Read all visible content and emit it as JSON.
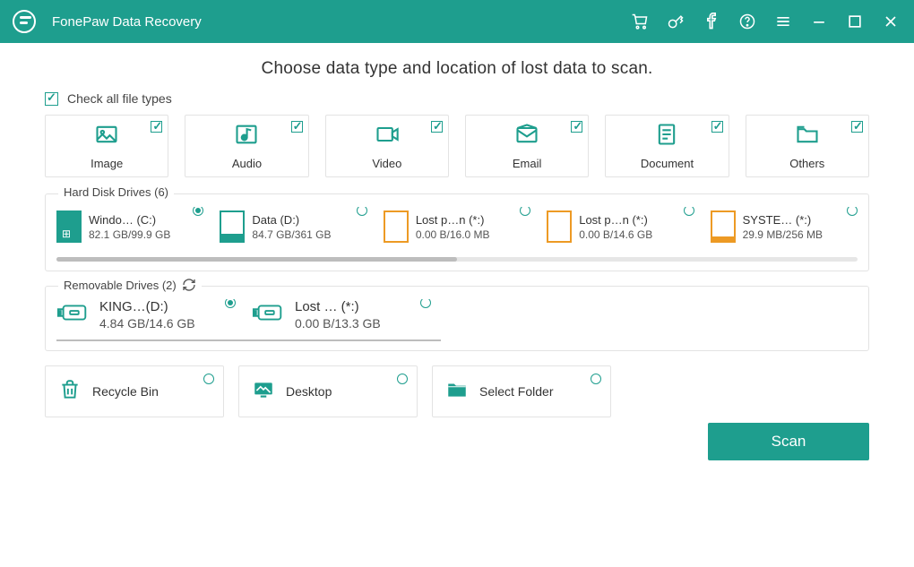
{
  "app_title": "FonePaw Data Recovery",
  "heading": "Choose data type and location of lost data to scan.",
  "check_all_label": "Check all file types",
  "types": [
    {
      "label": "Image"
    },
    {
      "label": "Audio"
    },
    {
      "label": "Video"
    },
    {
      "label": "Email"
    },
    {
      "label": "Document"
    },
    {
      "label": "Others"
    }
  ],
  "hdd_title": "Hard Disk Drives (6)",
  "hdd": [
    {
      "name": "Windo… (C:)",
      "size": "82.1 GB/99.9 GB",
      "selected": true,
      "style": "full-teal",
      "win": true
    },
    {
      "name": "Data (D:)",
      "size": "84.7 GB/361 GB",
      "selected": false,
      "style": "p-teal"
    },
    {
      "name": "Lost p…n (*:)",
      "size": "0.00  B/16.0 MB",
      "selected": false,
      "style": "orange"
    },
    {
      "name": "Lost p…n (*:)",
      "size": "0.00  B/14.6 GB",
      "selected": false,
      "style": "orange"
    },
    {
      "name": "SYSTE… (*:)",
      "size": "29.9 MB/256 MB",
      "selected": false,
      "style": "orange-bar"
    }
  ],
  "rem_title": "Removable Drives (2)",
  "rem": [
    {
      "name": "KING…(D:)",
      "size": "4.84 GB/14.6 GB",
      "selected": true
    },
    {
      "name": "Lost … (*:)",
      "size": "0.00  B/13.3 GB",
      "selected": false
    }
  ],
  "locations": [
    {
      "label": "Recycle Bin",
      "icon": "recycle"
    },
    {
      "label": "Desktop",
      "icon": "desktop"
    },
    {
      "label": "Select Folder",
      "icon": "folder"
    }
  ],
  "scan_label": "Scan"
}
